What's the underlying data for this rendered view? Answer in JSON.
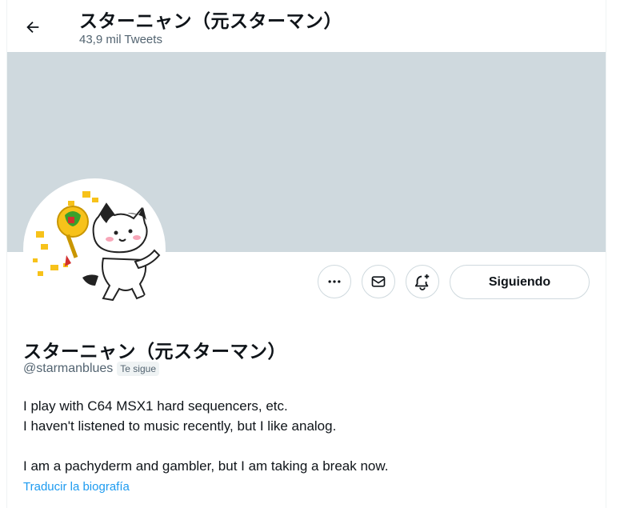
{
  "header": {
    "title": "スターニャン（元スターマン）",
    "tweet_count": "43,9 mil Tweets",
    "back_icon": "arrow-left-icon"
  },
  "profile": {
    "display_name": "スターニャン（元スターマン）",
    "handle": "@starmanblues",
    "follows_you_badge": "Te sigue",
    "bio_lines": [
      "I play with C64 MSX1 hard sequencers, etc.",
      "I haven't listened to music recently, but I like analog.",
      "",
      "I am a pachyderm and gambler, but I am taking a break now."
    ],
    "translate_link": "Traducir la biografía"
  },
  "actions": {
    "more_icon": "more-horizontal-icon",
    "message_icon": "envelope-icon",
    "notify_icon": "bell-plus-icon",
    "follow_label": "Siguiendo"
  },
  "colors": {
    "banner": "#cfd9de",
    "link": "#1d9bf0",
    "secondary_text": "#536471",
    "primary_text": "#0f1419"
  }
}
